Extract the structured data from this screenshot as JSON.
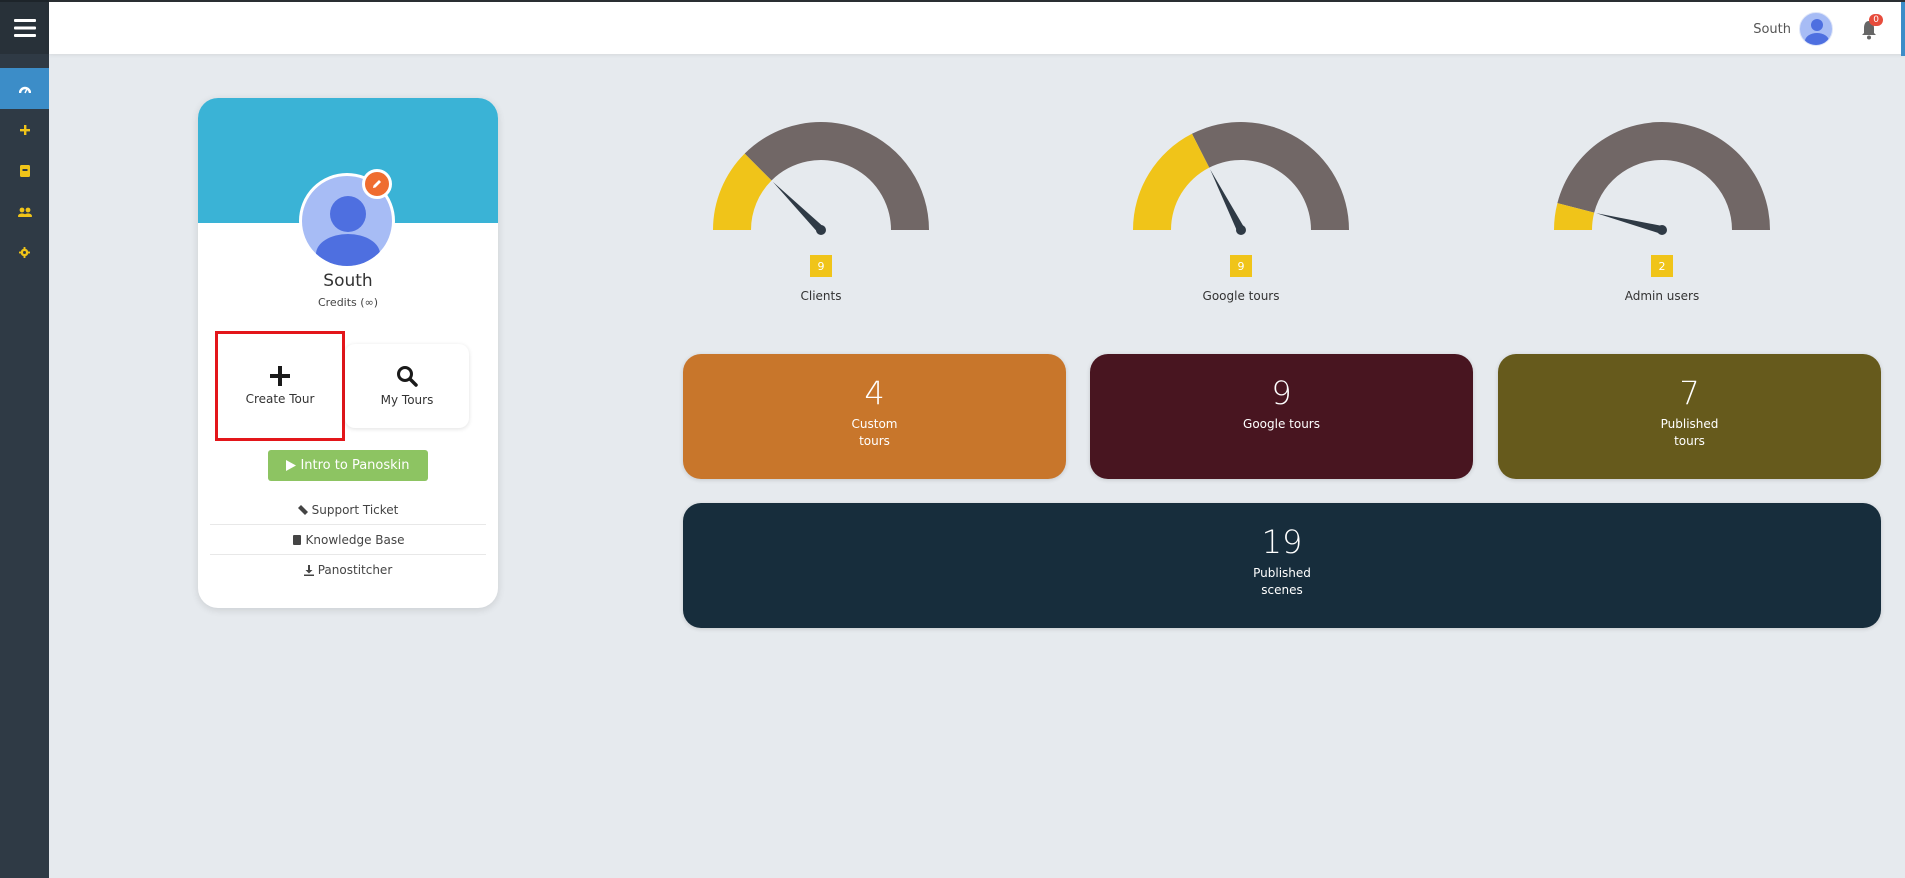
{
  "topbar": {
    "username": "South",
    "notification_count": "0"
  },
  "profile": {
    "name": "South",
    "credits": "Credits (∞)",
    "create_tour_label": "Create Tour",
    "my_tours_label": "My Tours",
    "intro_label": "Intro to Panoskin",
    "links": [
      "Support Ticket",
      "Knowledge Base",
      "Panostitcher"
    ]
  },
  "gauges": [
    {
      "label": "Clients",
      "value": "9",
      "fraction": 0.25
    },
    {
      "label": "Google tours",
      "value": "9",
      "fraction": 0.35
    },
    {
      "label": "Admin users",
      "value": "2",
      "fraction": 0.08
    }
  ],
  "tiles": [
    {
      "value": "4",
      "label": "Custom tours",
      "color": "#c8762b"
    },
    {
      "value": "9",
      "label": "Google tours",
      "color": "#481520"
    },
    {
      "value": "7",
      "label": "Published tours",
      "color": "#665a1c"
    },
    {
      "value": "19",
      "label": "Published scenes",
      "color": "#172d3c"
    }
  ],
  "colors": {
    "gauge_fill": "#f0c419",
    "gauge_track": "#716766",
    "needle": "#2f3a45",
    "sidebar": "#2f3a45",
    "accent": "#3c8dc8"
  },
  "icons": [
    "menu-icon",
    "dashboard-icon",
    "plus-icon",
    "book-icon",
    "users-icon",
    "gear-icon",
    "bell-icon",
    "pencil-icon",
    "search-icon",
    "play-icon"
  ]
}
